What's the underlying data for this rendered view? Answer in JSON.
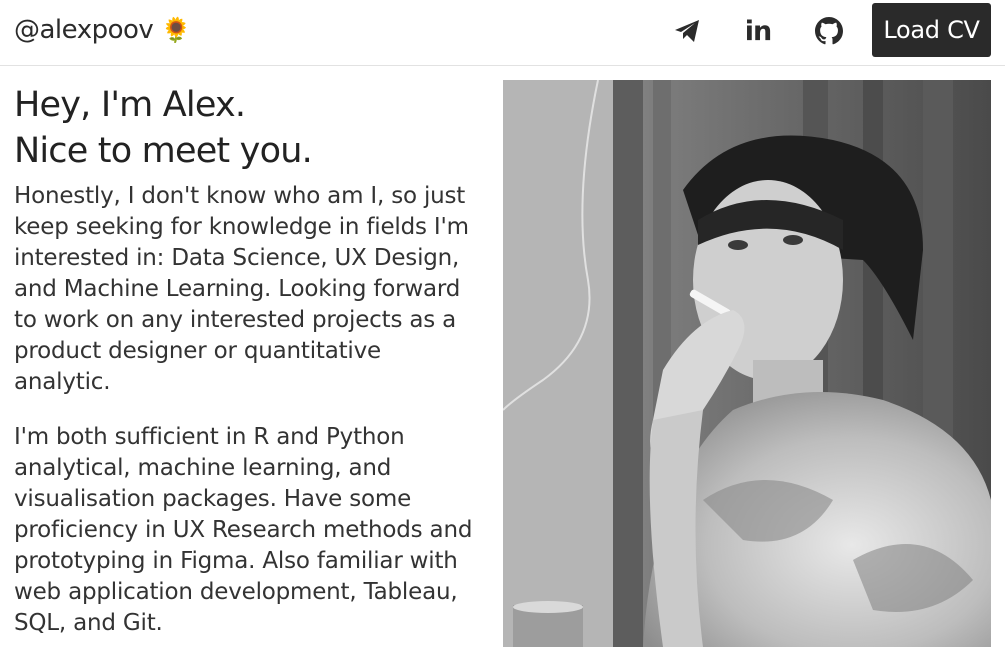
{
  "header": {
    "brand": "@alexpoov",
    "brand_emoji": "🌻",
    "nav_icons": [
      "telegram-icon",
      "linkedin-icon",
      "github-icon"
    ],
    "linkedin_text": "in",
    "cv_button": "Load CV"
  },
  "main": {
    "headline_line1": "Hey, I'm Alex.",
    "headline_line2": "Nice to meet you.",
    "paragraph1": "Honestly, I don't know who am I, so just keep seeking for knowledge in fields I'm interested in: Data Science, UX Design, and Machine Learning. Looking forward to work on any interested projects as a product designer or quantitative analytic.",
    "paragraph2": "I'm both sufficient in R and Python analytical, machine learning, and visualisation packages. Have some proficiency in UX Research methods and prototyping in Figma. Also familiar with web application development, Tableau, SQL, and Git."
  },
  "colors": {
    "text": "#333333",
    "button_bg": "#2a2a2a",
    "button_text": "#ffffff",
    "divider": "#e2e2e2"
  }
}
